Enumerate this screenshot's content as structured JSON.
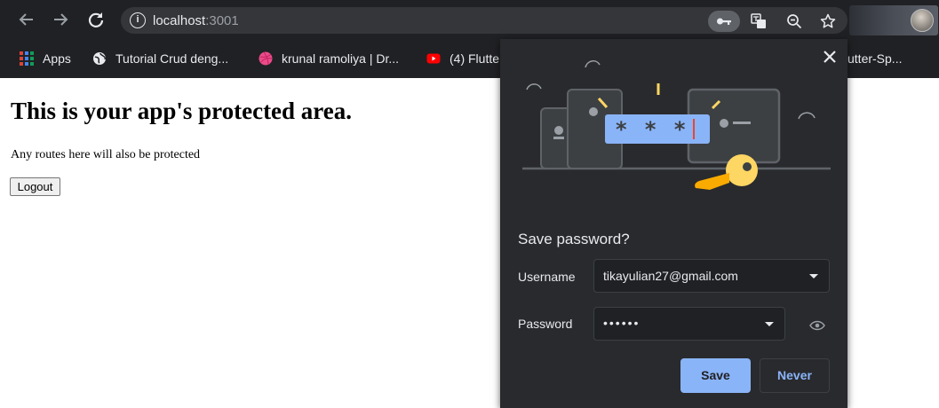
{
  "browser": {
    "url_host": "localhost",
    "url_port": ":3001"
  },
  "bookmarks": [
    {
      "label": "Apps",
      "icon": "apps-grid-icon"
    },
    {
      "label": "Tutorial Crud deng...",
      "icon": "globe-icon"
    },
    {
      "label": "krunal ramoliya | Dr...",
      "icon": "dribbble-icon"
    },
    {
      "label": "(4) Flutte",
      "icon": "youtube-icon"
    },
    {
      "label": "utter-Sp...",
      "icon": "bookmark-icon"
    }
  ],
  "page": {
    "title": "This is your app's protected area.",
    "text": "Any routes here will also be protected",
    "logout_label": "Logout"
  },
  "save_password": {
    "title": "Save password?",
    "username_label": "Username",
    "username_value": "tikayulian27@gmail.com",
    "password_label": "Password",
    "password_value": "••••••",
    "illustration_mask": "* * *",
    "save_label": "Save",
    "never_label": "Never"
  },
  "colors": {
    "chrome_bg": "#202124",
    "bubble_bg": "#292a2d",
    "accent": "#8ab4f8",
    "key_yellow": "#fdd663"
  }
}
